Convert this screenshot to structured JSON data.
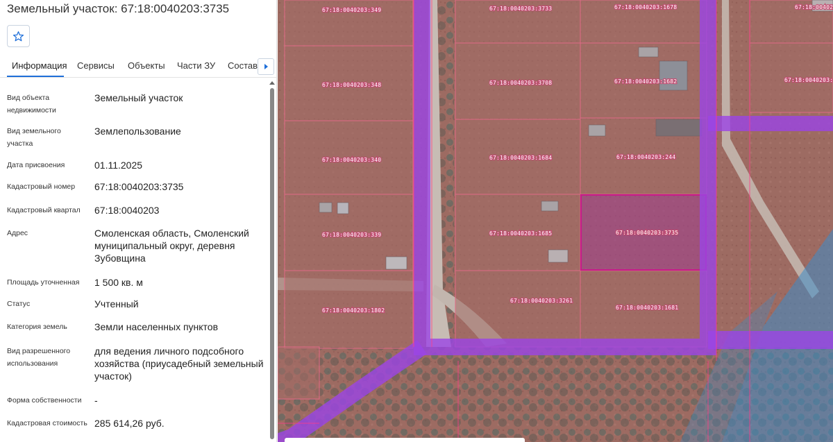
{
  "header": {
    "title": "Земельный участок: 67:18:0040203:3735"
  },
  "tabs": [
    {
      "label": "Информация"
    },
    {
      "label": "Сервисы"
    },
    {
      "label": "Объекты"
    },
    {
      "label": "Части ЗУ"
    },
    {
      "label": "Состав"
    }
  ],
  "info": {
    "rows": [
      {
        "label": "Вид объекта недвижимости",
        "value": "Земельный участок"
      },
      {
        "label": "Вид земельного участка",
        "value": "Землепользование"
      },
      {
        "label": "Дата присвоения",
        "value": "01.11.2025"
      },
      {
        "label": "Кадастровый номер",
        "value": "67:18:0040203:3735"
      },
      {
        "label": "Кадастровый квартал",
        "value": "67:18:0040203"
      },
      {
        "label": "Адрес",
        "value": "Смоленская область, Смоленский муниципальный округ, деревня Зубовщина"
      },
      {
        "label": "Площадь уточненная",
        "value": "1 500 кв. м"
      },
      {
        "label": "Статус",
        "value": "Учтенный"
      },
      {
        "label": "Категория земель",
        "value": "Земли населенных пунктов"
      },
      {
        "label": "Вид разрешенного использования",
        "value": "для ведения личного подсобного хозяйства (приусадебный земельный участок)"
      },
      {
        "label": "Форма собственности",
        "value": "-"
      },
      {
        "label": "Кадастровая стоимость",
        "value": "285 614,26 руб."
      }
    ]
  },
  "map": {
    "parcels": [
      {
        "label": "67:18:0040203:349"
      },
      {
        "label": "67:18:0040203:3733"
      },
      {
        "label": "67:18:0040203:1678"
      },
      {
        "label": "67:18:0040203:1"
      },
      {
        "label": "67:18:0040203:348"
      },
      {
        "label": "67:18:0040203:3708"
      },
      {
        "label": "67:18:0040203:1682"
      },
      {
        "label": "67:18:0040203:1"
      },
      {
        "label": "67:18:0040203:340"
      },
      {
        "label": "67:18:0040203:1684"
      },
      {
        "label": "67:18:0040203:244"
      },
      {
        "label": "67:18:0040203:339"
      },
      {
        "label": "67:18:0040203:1685"
      },
      {
        "label": "67:18:0040203:3735"
      },
      {
        "label": "67:18:0040203:1802"
      },
      {
        "label": "67:18:0040203:3261"
      },
      {
        "label": "67:18:0040203:1681"
      }
    ],
    "colors": {
      "parcel_fill": "#a36c66",
      "selected_fill": "#a0418c",
      "zone_stroke": "#9b45e6",
      "road": "#c4b8b1",
      "water_zone": "#3c8cc8"
    }
  }
}
